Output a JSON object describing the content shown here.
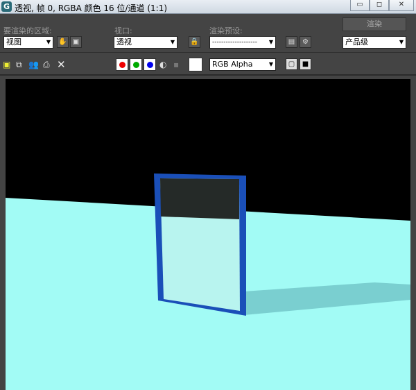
{
  "titlebar": {
    "title": "透视, 帧 0, RGBA 颜色 16 位/通道 (1:1)",
    "minimize": "▭",
    "maximize": "◻",
    "close": "✕"
  },
  "controls": {
    "area_label": "要渲染的区域:",
    "area_value": "视图",
    "viewport_label": "视口:",
    "viewport_value": "透视",
    "preset_label": "渲染预设:",
    "preset_value": "--------------------",
    "render_button": "渲染",
    "quality_value": "产品级"
  },
  "toolbar": {
    "channel_value": "RGB Alpha"
  },
  "colors": {
    "sky": "#000000",
    "floor": "#a2fbf5",
    "frame": "#1a4fb8",
    "shadow": "#7acfd0"
  }
}
